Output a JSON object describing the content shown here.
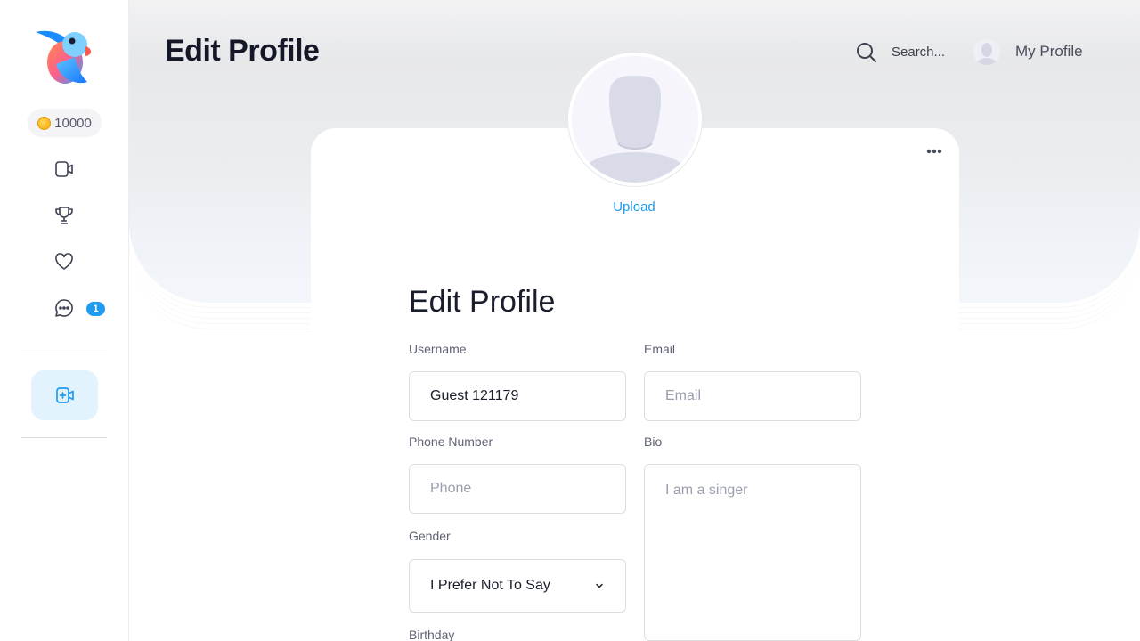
{
  "sidebar": {
    "coins": "10000",
    "messages_badge": "1",
    "nav_icons": [
      "video-icon",
      "trophy-icon",
      "heart-icon",
      "chat-icon"
    ],
    "create_icon": "add-video-icon"
  },
  "header": {
    "title": "Edit Profile",
    "search_label": "Search...",
    "profile_label": "My Profile"
  },
  "profile": {
    "upload_label": "Upload",
    "form_title": "Edit Profile",
    "fields": {
      "username": {
        "label": "Username",
        "value": "Guest 121179"
      },
      "email": {
        "label": "Email",
        "placeholder": "Email"
      },
      "phone": {
        "label": "Phone Number",
        "placeholder": "Phone"
      },
      "bio": {
        "label": "Bio",
        "placeholder": "I am a singer"
      },
      "gender": {
        "label": "Gender",
        "value": "I Prefer Not To Say"
      },
      "birthday": {
        "label": "Birthday"
      }
    }
  },
  "colors": {
    "accent": "#1f9cf0",
    "accent_soft": "#e3f3fd"
  }
}
